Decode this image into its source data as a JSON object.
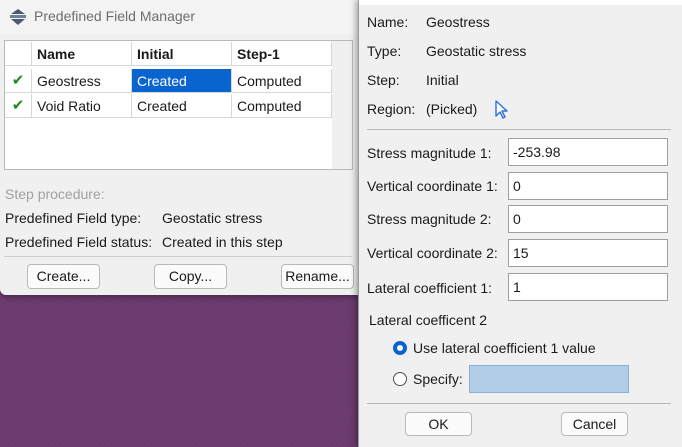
{
  "manager": {
    "title": "Predefined Field Manager",
    "columns": [
      "",
      "Name",
      "Initial",
      "Step-1"
    ],
    "rows": [
      {
        "check": "✔",
        "name": "Geostress",
        "initial": "Created",
        "step1": "Computed",
        "selected_cell": "initial"
      },
      {
        "check": "✔",
        "name": "Void Ratio",
        "initial": "Created",
        "step1": "Computed"
      }
    ],
    "step_procedure_label": "Step procedure:",
    "field_type_label": "Predefined Field type:",
    "field_type_value": "Geostatic stress",
    "field_status_label": "Predefined Field status:",
    "field_status_value": "Created in this step",
    "buttons": {
      "create": "Create...",
      "copy": "Copy...",
      "rename": "Rename..."
    }
  },
  "editor": {
    "name_label": "Name:",
    "name_value": "Geostress",
    "type_label": "Type:",
    "type_value": "Geostatic stress",
    "step_label": "Step:",
    "step_value": "Initial",
    "region_label": "Region:",
    "region_value": "(Picked)",
    "fields": [
      {
        "label": "Stress magnitude 1:",
        "value": "-253.98"
      },
      {
        "label": "Vertical coordinate 1:",
        "value": "0"
      },
      {
        "label": "Stress magnitude 2:",
        "value": "0"
      },
      {
        "label": "Vertical coordinate 2:",
        "value": "15"
      },
      {
        "label": "Lateral coefficient 1:",
        "value": "1"
      }
    ],
    "lateral_group_title": "Lateral coefficent 2",
    "option_use_lc1": "Use lateral coefficient 1 value",
    "option_specify": "Specify:",
    "specify_value": "",
    "ok": "OK",
    "cancel": "Cancel"
  },
  "colors": {
    "selection": "#0a64d0",
    "check": "#1f8a1f",
    "specify_field": "#b2cde8",
    "desktop": "#6a3a6e"
  }
}
